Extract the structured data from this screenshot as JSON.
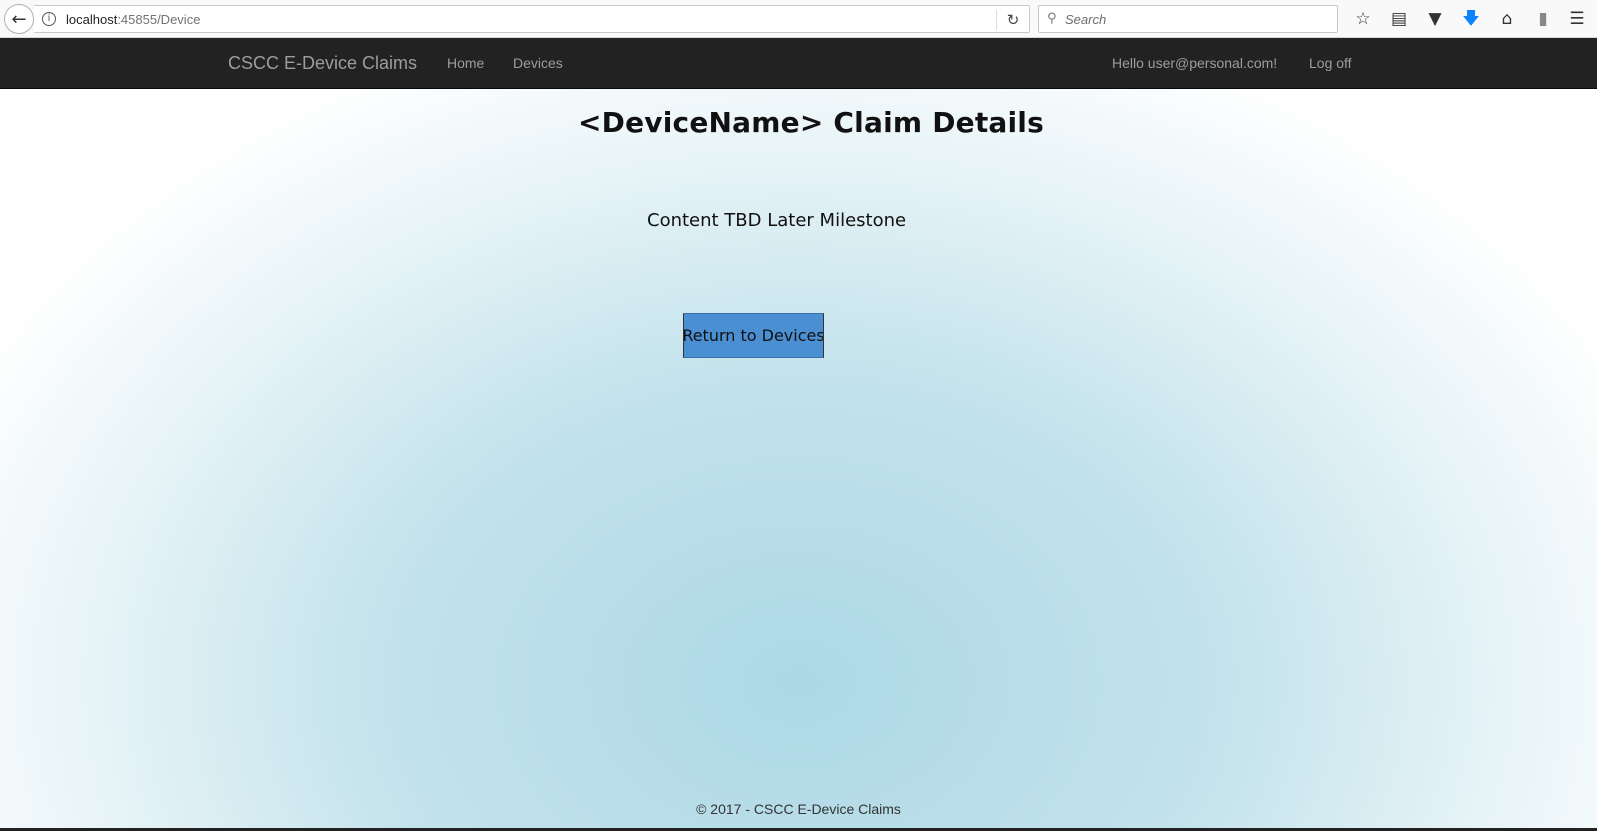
{
  "browser": {
    "url_host": "localhost",
    "url_path": ":45855/Device",
    "search_placeholder": "Search"
  },
  "navbar": {
    "brand": "CSCC E-Device Claims",
    "links": [
      "Home",
      "Devices"
    ],
    "greeting": "Hello user@personal.com!",
    "logoff": "Log off"
  },
  "main": {
    "title": "<DeviceName> Claim Details",
    "content": "Content TBD Later Milestone",
    "return_button": "Return to Devices"
  },
  "footer": {
    "text": "© 2017 - CSCC E-Device Claims"
  }
}
